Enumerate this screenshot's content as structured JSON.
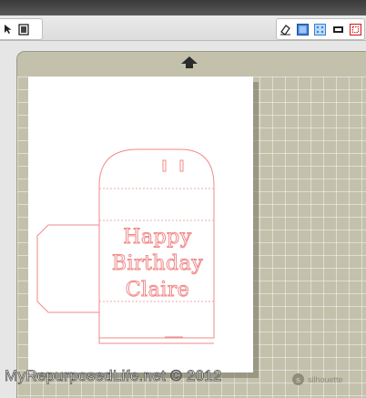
{
  "toolbar": {
    "left_icons": [
      "pointer-icon",
      "page-setup-icon"
    ],
    "right_icons": [
      "eraser-icon",
      "grid-icon",
      "pattern-fill-icon",
      "cut-icon",
      "registration-marks-icon"
    ]
  },
  "card": {
    "line1": "Happy",
    "line2": "Birthday",
    "line3": "Claire"
  },
  "watermark": "MyRepurposedLife.net © 2012",
  "brand": {
    "mark": "s",
    "text": "silhouette"
  },
  "colors": {
    "cut_line": "#f08a8a",
    "mat": "#c3c1ac",
    "page": "#ffffff"
  }
}
